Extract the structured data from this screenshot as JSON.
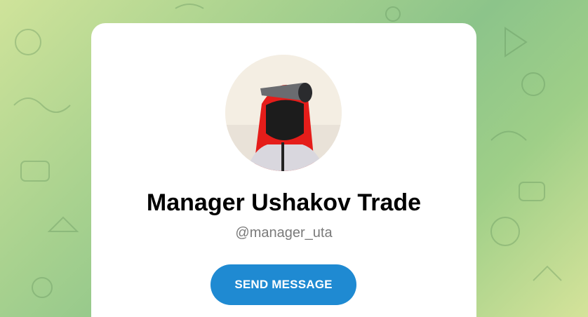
{
  "profile": {
    "name": "Manager Ushakov Trade",
    "username": "@manager_uta",
    "avatar_icon": "profile-photo"
  },
  "actions": {
    "send_message_label": "SEND MESSAGE"
  },
  "colors": {
    "button": "#1f8ad2",
    "username": "#7a7a7a",
    "card": "#ffffff"
  }
}
